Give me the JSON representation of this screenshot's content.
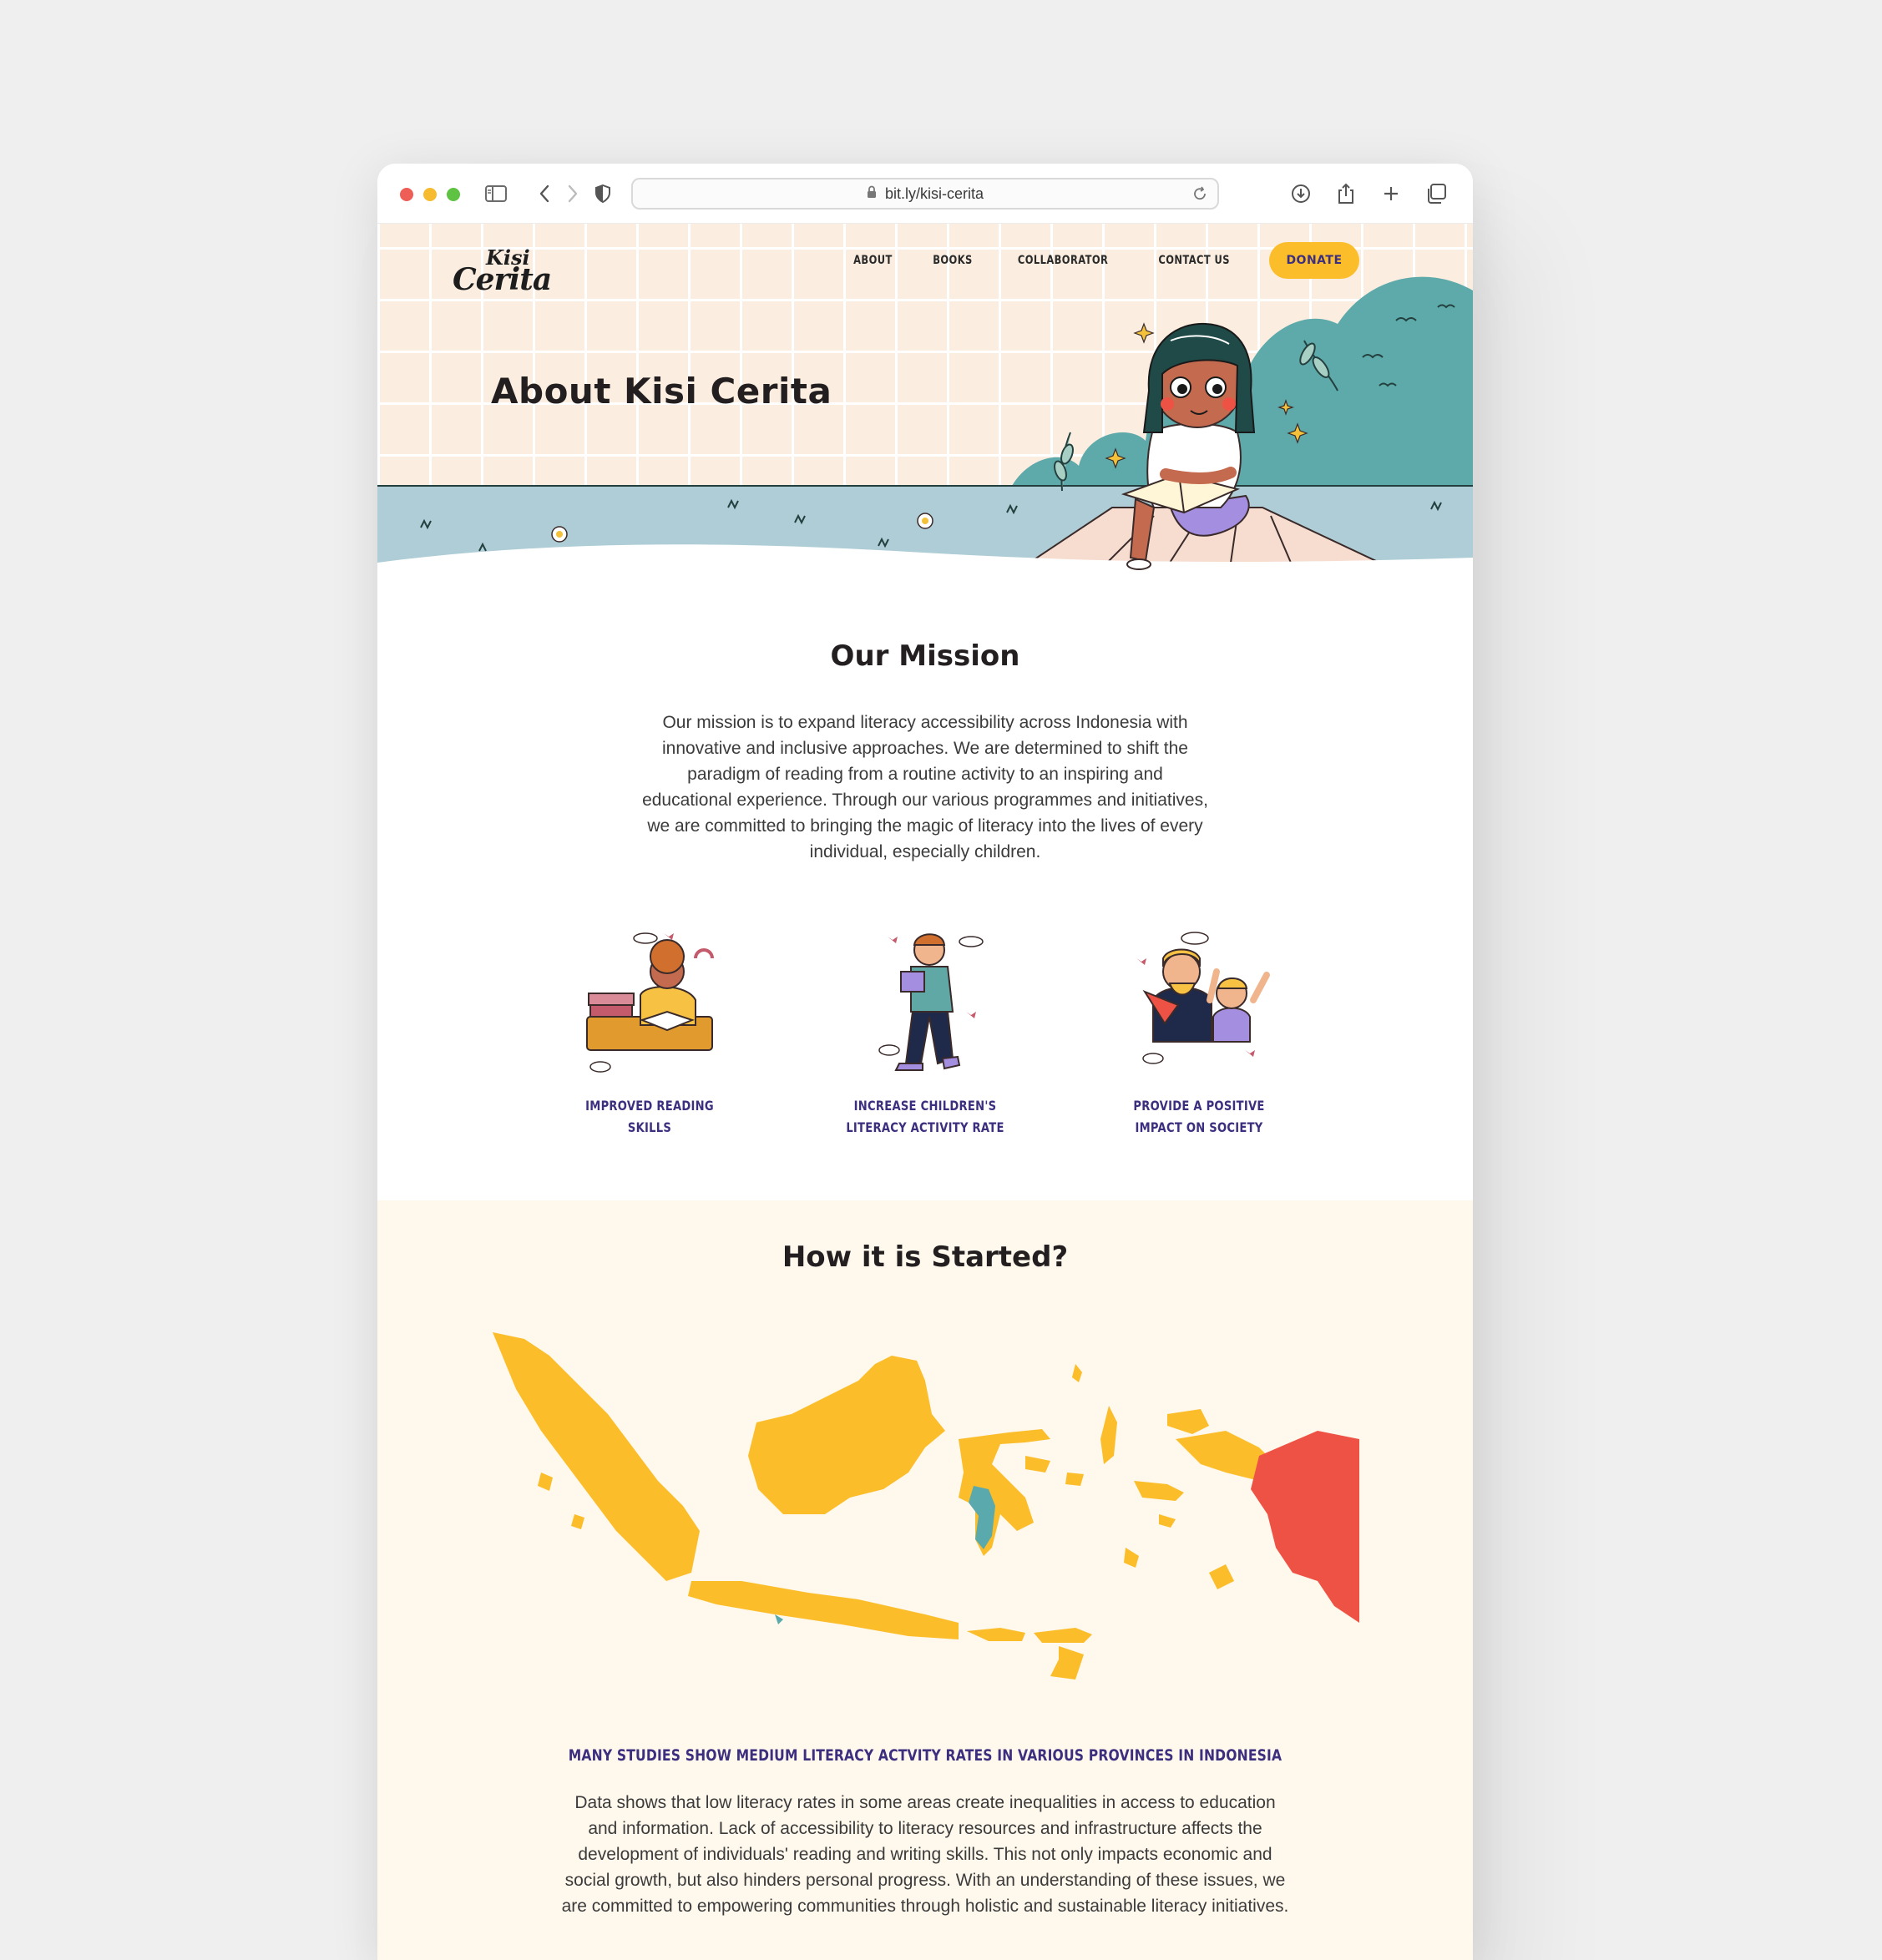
{
  "browser": {
    "url": "bit.ly/kisi-cerita"
  },
  "header": {
    "logo_line1": "Kisi",
    "logo_line2": "Cerita",
    "nav": [
      "ABOUT",
      "BOOKS",
      "COLLABORATOR",
      "CONTACT US"
    ],
    "donate_label": "DONATE"
  },
  "hero": {
    "title": "About Kisi Cerita"
  },
  "mission": {
    "title": "Our Mission",
    "text": "Our mission is to expand literacy accessibility across Indonesia with innovative and inclusive approaches. We are determined to shift the paradigm of reading from a routine activity to an inspiring and educational experience. Through our various programmes and initiatives, we are committed to bringing the magic of literacy into the lives of every individual, especially children.",
    "features": [
      {
        "label": "IMPROVED READING SKILLS"
      },
      {
        "label": "INCREASE CHILDREN'S LITERACY ACTIVITY RATE"
      },
      {
        "label": "PROVIDE A POSITIVE IMPACT ON SOCIETY"
      }
    ]
  },
  "started": {
    "title": "How it is Started?",
    "studies": "MANY STUDIES SHOW MEDIUM LITERACY ACTVITY RATES IN VARIOUS PROVINCES IN INDONESIA",
    "text": "Data shows that low literacy rates in some areas create inequalities in access to education and information. Lack of accessibility to literacy resources and infrastructure affects the development of individuals' reading and writing skills. This not only impacts economic and social growth, but also hinders personal progress. With an understanding of these issues, we are committed to empowering communities through holistic and sustainable literacy initiatives."
  },
  "colors": {
    "accent_yellow": "#fbbd2a",
    "accent_purple": "#3d2f7f",
    "map_teal": "#5aa9ad",
    "map_red": "#ee5245"
  }
}
